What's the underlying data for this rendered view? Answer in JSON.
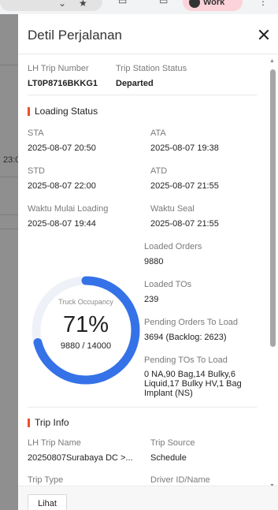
{
  "browser": {
    "profile_label": "Work"
  },
  "background": {
    "partial_text": "23:0"
  },
  "drawer": {
    "title": "Detil Perjalanan",
    "trip_number": {
      "label": "LH Trip Number",
      "value": "LT0P8716BKKG1"
    },
    "station_status": {
      "label": "Trip Station Status",
      "value": "Departed"
    },
    "loading_status": {
      "title": "Loading Status",
      "sta": {
        "label": "STA",
        "value": "2025-08-07 20:50"
      },
      "ata": {
        "label": "ATA",
        "value": "2025-08-07 19:38"
      },
      "std": {
        "label": "STD",
        "value": "2025-08-07 22:00"
      },
      "atd": {
        "label": "ATD",
        "value": "2025-08-07 21:55"
      },
      "loading_start": {
        "label": "Waktu Mulai Loading",
        "value": "2025-08-07 19:44"
      },
      "seal_time": {
        "label": "Waktu Seal",
        "value": "2025-08-07 21:55"
      },
      "occupancy": {
        "label": "Truck Occupancy",
        "percent_text": "71%",
        "percent": 71,
        "count_text": "9880 / 14000",
        "color": "#3572e8",
        "track_color": "#eef1f7"
      },
      "loaded_orders": {
        "label": "Loaded Orders",
        "value": "9880"
      },
      "loaded_tos": {
        "label": "Loaded TOs",
        "value": "239"
      },
      "pending_orders": {
        "label": "Pending Orders To Load",
        "value": "3694 (Backlog: 2623)"
      },
      "pending_tos": {
        "label": "Pending TOs To Load",
        "lines": [
          "0 NA,90 Bag,14 Bulky,6",
          "Liquid,17 Bulky HV,1 Bag",
          "Implant (NS)"
        ]
      }
    },
    "trip_info": {
      "title": "Trip Info",
      "trip_name": {
        "label": "LH Trip Name",
        "value": "20250807Surabaya DC >..."
      },
      "trip_source": {
        "label": "Trip Source",
        "value": "Schedule"
      },
      "trip_type": {
        "label": "Trip Type"
      },
      "driver": {
        "label": "Driver ID/Name"
      }
    },
    "footer": {
      "view_button": "Lihat"
    },
    "accent_color": "#ee4d2d"
  }
}
